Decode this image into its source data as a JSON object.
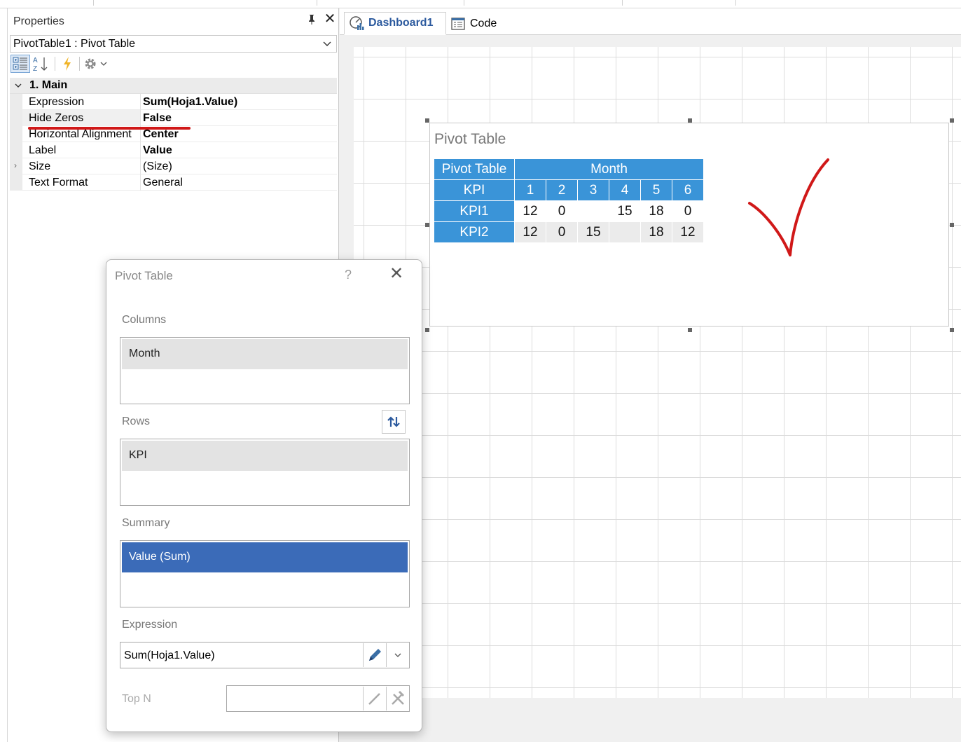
{
  "properties_panel": {
    "title": "Properties",
    "selected_object": "PivotTable1 : Pivot Table",
    "category": "1. Main",
    "rows": [
      {
        "name": "Expression",
        "value": "Sum(Hoja1.Value)",
        "bold": true
      },
      {
        "name": "Hide Zeros",
        "value": "False",
        "bold": true
      },
      {
        "name": "Horizontal Alignment",
        "value": "Center",
        "bold": true
      },
      {
        "name": "Label",
        "value": "Value",
        "bold": true
      },
      {
        "name": "Size",
        "value": "(Size)",
        "bold": false
      },
      {
        "name": "Text Format",
        "value": "General",
        "bold": false
      }
    ]
  },
  "tabs": [
    {
      "label": "Dashboard1",
      "active": true
    },
    {
      "label": "Code",
      "active": false
    }
  ],
  "widget": {
    "title": "Pivot Table",
    "corner_header": "Pivot Table",
    "column_header": "Month",
    "row_header": "KPI",
    "months": [
      "1",
      "2",
      "3",
      "4",
      "5",
      "6"
    ],
    "rows": [
      {
        "label": "KPI1",
        "values": [
          "12",
          "0",
          "",
          "15",
          "18",
          "0"
        ]
      },
      {
        "label": "KPI2",
        "values": [
          "12",
          "0",
          "15",
          "",
          "18",
          "12"
        ]
      }
    ],
    "header_color": "#3a94d8"
  },
  "dialog": {
    "title": "Pivot Table",
    "help": "?",
    "columns_label": "Columns",
    "columns_item": "Month",
    "rows_label": "Rows",
    "rows_item": "KPI",
    "summary_label": "Summary",
    "summary_item": "Value (Sum)",
    "expression_label": "Expression",
    "expression_value": "Sum(Hoja1.Value)",
    "topn_label": "Top N",
    "selected_color": "#3b6bb8"
  },
  "annotation_color": "#d01818"
}
